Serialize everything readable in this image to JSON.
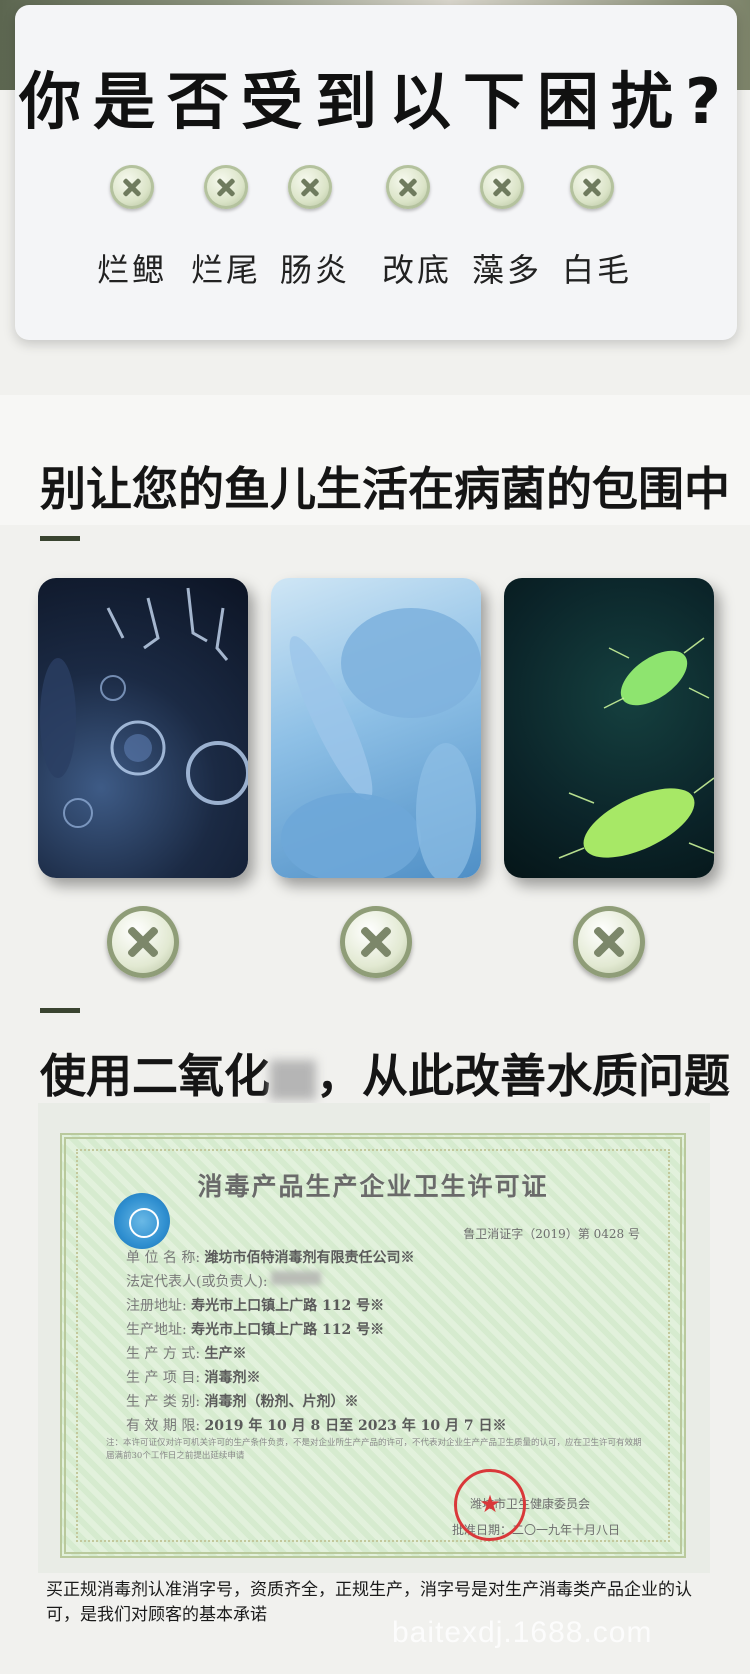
{
  "troubles": {
    "title": "你是否受到以下困扰?",
    "items": [
      "烂鳃",
      "烂尾",
      "肠炎",
      "改底",
      "藻多",
      "白毛"
    ]
  },
  "section_bacteria": {
    "heading": "别让您的鱼儿生活在病菌的包围中"
  },
  "section_solution": {
    "heading_before": "使用二氧化",
    "heading_after": "，从此改善水质问题"
  },
  "certificate": {
    "title": "消毒产品生产企业卫生许可证",
    "number": "鲁卫消证字（2019）第 0428 号",
    "rows": [
      {
        "label": "单 位 名 称:",
        "value": "潍坊市佰特消毒剂有限责任公司※"
      },
      {
        "label": "法定代表人(或负责人):",
        "value": ""
      },
      {
        "label": "注册地址:",
        "value": "寿光市上口镇上广路 112 号※"
      },
      {
        "label": "生产地址:",
        "value": "寿光市上口镇上广路 112 号※"
      },
      {
        "label": "生 产 方 式:",
        "value": "生产※"
      },
      {
        "label": "生 产 项 目:",
        "value": "消毒剂※"
      },
      {
        "label": "生 产 类 别:",
        "value": "消毒剂（粉剂、片剂）※"
      },
      {
        "label": "有 效 期 限:",
        "value": "2019 年 10 月 8 日至 2023 年 10 月 7 日※"
      }
    ],
    "note": "注：本许可证仅对许可机关许可的生产条件负责，不是对企业所生产产品的许可，不代表对企业生产产品卫生质量的认可，应在卫生许可有效期届满前30个工作日之前提出延续申请",
    "issuer": "潍坊市卫生健康委员会",
    "date": "批准日期：二〇一九年十月八日"
  },
  "footer": {
    "text": "买正规消毒剂认准消字号，资质齐全，正规生产，消字号是对生产消毒类产品企业的认可，是我们对顾客的基本承诺"
  },
  "watermark": "baitexdj.1688.com",
  "colors": {
    "background": "#f1f1ee",
    "accent_dash": "#3a4430",
    "x_icon": "#7c876a",
    "seal_red": "#d9383a"
  }
}
